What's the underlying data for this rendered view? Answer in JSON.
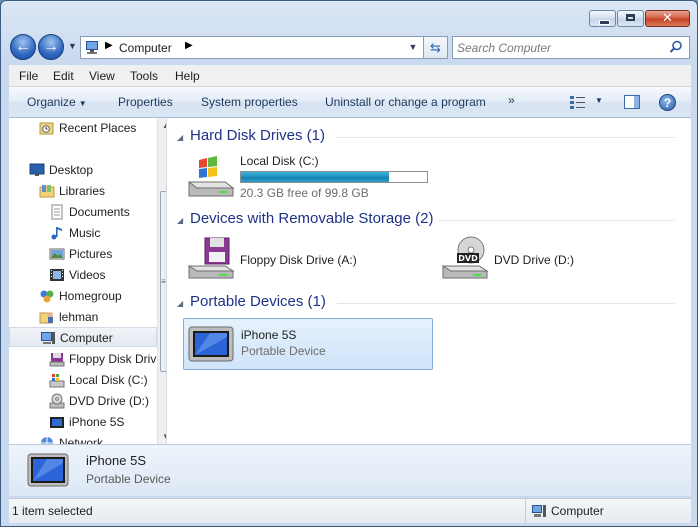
{
  "window": {
    "caption_buttons": [
      "minimize",
      "maximize",
      "close"
    ]
  },
  "address_bar": {
    "crumb": "Computer",
    "icon": "computer-icon"
  },
  "search": {
    "placeholder": "Search Computer"
  },
  "menu": {
    "items": [
      "File",
      "Edit",
      "View",
      "Tools",
      "Help"
    ]
  },
  "commands": {
    "organize": "Organize",
    "properties": "Properties",
    "system_properties": "System properties",
    "uninstall": "Uninstall or change a program",
    "more": "»"
  },
  "nav_pane": {
    "items": [
      {
        "label": "Recent Places",
        "icon": "recent-places-icon"
      },
      {
        "label": "Desktop",
        "icon": "desktop-icon"
      },
      {
        "label": "Libraries",
        "icon": "libraries-icon"
      },
      {
        "label": "Documents",
        "icon": "documents-icon"
      },
      {
        "label": "Music",
        "icon": "music-icon"
      },
      {
        "label": "Pictures",
        "icon": "pictures-icon"
      },
      {
        "label": "Videos",
        "icon": "videos-icon"
      },
      {
        "label": "Homegroup",
        "icon": "homegroup-icon"
      },
      {
        "label": "lehman",
        "icon": "user-folder-icon"
      },
      {
        "label": "Computer",
        "icon": "computer-icon",
        "selected": true
      },
      {
        "label": "Floppy Disk Drive (A:)",
        "icon": "floppy-icon"
      },
      {
        "label": "Local Disk (C:)",
        "icon": "local-disk-icon"
      },
      {
        "label": "DVD Drive (D:)",
        "icon": "dvd-icon"
      },
      {
        "label": "iPhone 5S",
        "icon": "portable-device-icon"
      },
      {
        "label": "Network",
        "icon": "network-icon"
      }
    ]
  },
  "groups": {
    "hard_disk": {
      "title": "Hard Disk Drives (1)",
      "drive": {
        "name": "Local Disk (C:)",
        "free_text": "20.3 GB free of 99.8 GB",
        "used_fraction": 0.797
      }
    },
    "removable": {
      "title": "Devices with Removable Storage (2)",
      "floppy": "Floppy Disk Drive (A:)",
      "dvd": "DVD Drive (D:)"
    },
    "portable": {
      "title": "Portable Devices (1)",
      "device": {
        "name": "iPhone 5S",
        "type": "Portable Device"
      }
    }
  },
  "details": {
    "name": "iPhone 5S",
    "type": "Portable Device"
  },
  "status": {
    "selection": "1 item selected",
    "location": "Computer"
  },
  "colors": {
    "group_title": "#1e3287",
    "capacity_bar": "#1d8fbd",
    "selection_fill": "#cfe4fa"
  }
}
